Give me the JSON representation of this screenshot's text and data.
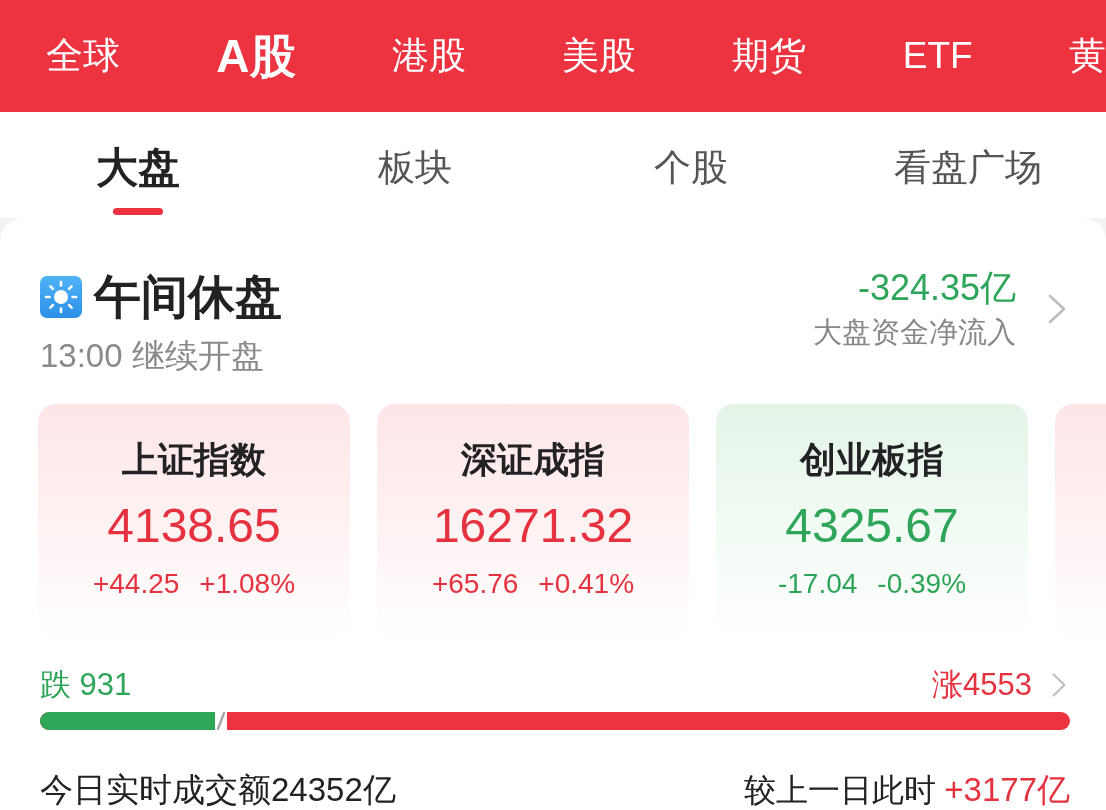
{
  "market_tabs": [
    {
      "label": "全球",
      "selected": false
    },
    {
      "label": "A股",
      "selected": true
    },
    {
      "label": "港股",
      "selected": false
    },
    {
      "label": "美股",
      "selected": false
    },
    {
      "label": "期货",
      "selected": false
    },
    {
      "label": "ETF",
      "selected": false
    },
    {
      "label": "黄",
      "selected": false
    }
  ],
  "sub_tabs": [
    {
      "label": "大盘",
      "selected": true
    },
    {
      "label": "板块",
      "selected": false
    },
    {
      "label": "个股",
      "selected": false
    },
    {
      "label": "看盘广场",
      "selected": false
    }
  ],
  "session": {
    "title": "午间休盘",
    "resume": "13:00 继续开盘",
    "net_flow": "-324.35亿",
    "net_flow_up": false,
    "net_flow_label": "大盘资金净流入"
  },
  "index_cards": [
    {
      "name": "上证指数",
      "value": "4138.65",
      "change": "+44.25",
      "change_pct": "+1.08%",
      "up": true
    },
    {
      "name": "深证成指",
      "value": "16271.32",
      "change": "+65.76",
      "change_pct": "+0.41%",
      "up": true
    },
    {
      "name": "创业板指",
      "value": "4325.67",
      "change": "-17.04",
      "change_pct": "-0.39%",
      "up": false
    },
    {
      "up": true
    }
  ],
  "breadth": {
    "fall": "跌 931",
    "rise": "涨4553",
    "level": 0.17
  },
  "turnover": {
    "text": "今日实时成交额24352亿",
    "compare_label": "较上一日此时",
    "compare_value": "+3177亿",
    "compare_up": true
  }
}
